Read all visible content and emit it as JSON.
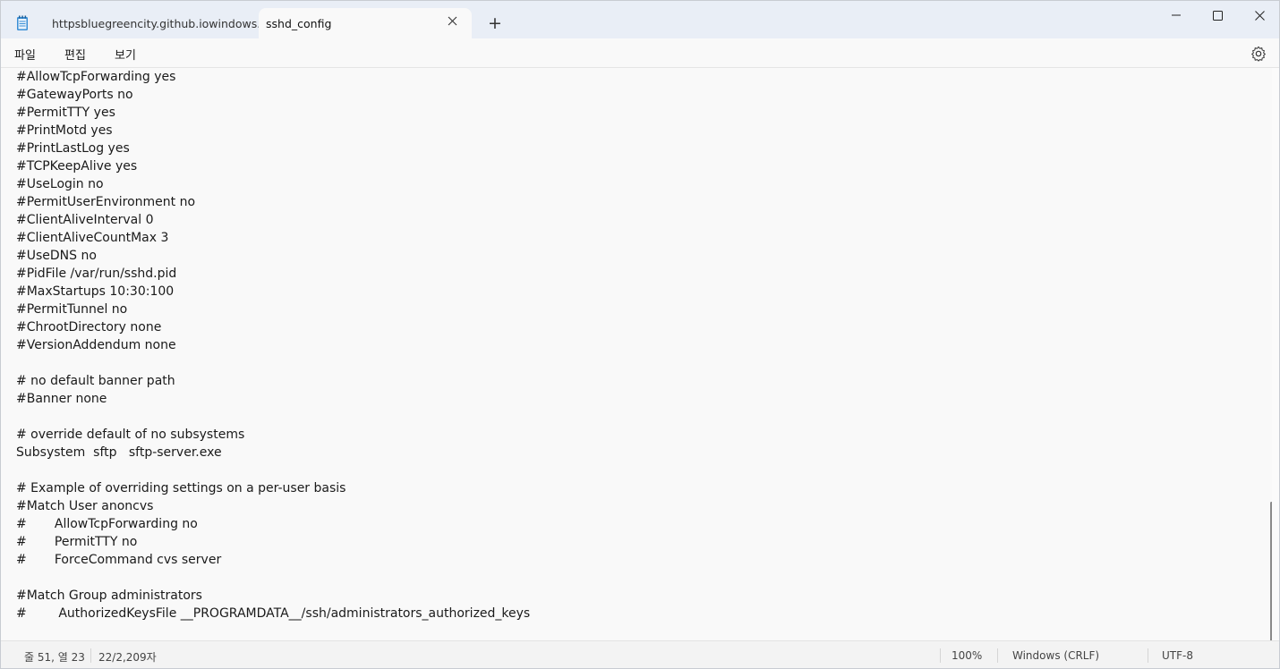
{
  "window": {
    "tabs": [
      {
        "label": "httpsbluegreencity.github.iowindows.txt",
        "active": false
      },
      {
        "label": "sshd_config",
        "active": true
      }
    ],
    "new_tab_icon": "+",
    "icons": {
      "app": "notepad-icon",
      "close": "close-icon",
      "settings": "gear-icon"
    }
  },
  "menu": {
    "file": "파일",
    "edit": "편집",
    "view": "보기"
  },
  "editor": {
    "lines": [
      "#AllowTcpForwarding yes",
      "#GatewayPorts no",
      "#PermitTTY yes",
      "#PrintMotd yes",
      "#PrintLastLog yes",
      "#TCPKeepAlive yes",
      "#UseLogin no",
      "#PermitUserEnvironment no",
      "#ClientAliveInterval 0",
      "#ClientAliveCountMax 3",
      "#UseDNS no",
      "#PidFile /var/run/sshd.pid",
      "#MaxStartups 10:30:100",
      "#PermitTunnel no",
      "#ChrootDirectory none",
      "#VersionAddendum none",
      "",
      "# no default banner path",
      "#Banner none",
      "",
      "# override default of no subsystems",
      "Subsystem  sftp   sftp-server.exe",
      "",
      "# Example of overriding settings on a per-user basis",
      "#Match User anoncvs",
      "#       AllowTcpForwarding no",
      "#       PermitTTY no",
      "#       ForceCommand cvs server",
      "",
      "#Match Group administrators",
      "#        AuthorizedKeysFile __PROGRAMDATA__/ssh/administrators_authorized_keys"
    ]
  },
  "status": {
    "position": "줄 51, 열 23",
    "count": "22/2,209자",
    "zoom": "100%",
    "line_ending": "Windows (CRLF)",
    "encoding": "UTF-8"
  }
}
